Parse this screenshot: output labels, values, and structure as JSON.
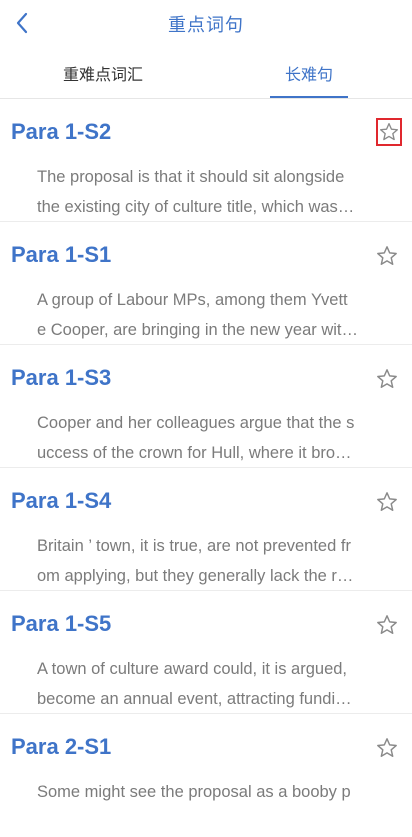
{
  "header": {
    "title": "重点词句",
    "back_icon": "chevron-left-icon"
  },
  "tabs": [
    {
      "label": "重难点词汇",
      "active": false
    },
    {
      "label": "长难句",
      "active": true
    }
  ],
  "items": [
    {
      "title": "Para 1-S2",
      "line1": "The proposal is that it should sit alongside",
      "line2": "the existing city of culture title, which was…",
      "star_highlighted": true
    },
    {
      "title": "Para 1-S1",
      "line1": "A group of Labour MPs, among them Yvett",
      "line2": "e Cooper, are bringing in the new year wit…",
      "star_highlighted": false
    },
    {
      "title": "Para 1-S3",
      "line1": "Cooper and her colleagues argue that the s",
      "line2": "uccess of the crown for Hull, where it bro…",
      "star_highlighted": false
    },
    {
      "title": "Para 1-S4",
      "line1": "Britain ’ town, it is true, are not prevented fr",
      "line2": "om applying, but they generally lack the r…",
      "star_highlighted": false
    },
    {
      "title": "Para 1-S5",
      "line1": "A town of culture award could, it is argued,",
      "line2": "become an annual event, attracting fundi…",
      "star_highlighted": false
    },
    {
      "title": "Para 2-S1",
      "line1": "Some might see the proposal as a booby p",
      "line2": "",
      "star_highlighted": false
    }
  ],
  "colors": {
    "accent": "#3f74c8",
    "highlight_border": "#e0282e",
    "body_text": "#7b7b7b"
  }
}
